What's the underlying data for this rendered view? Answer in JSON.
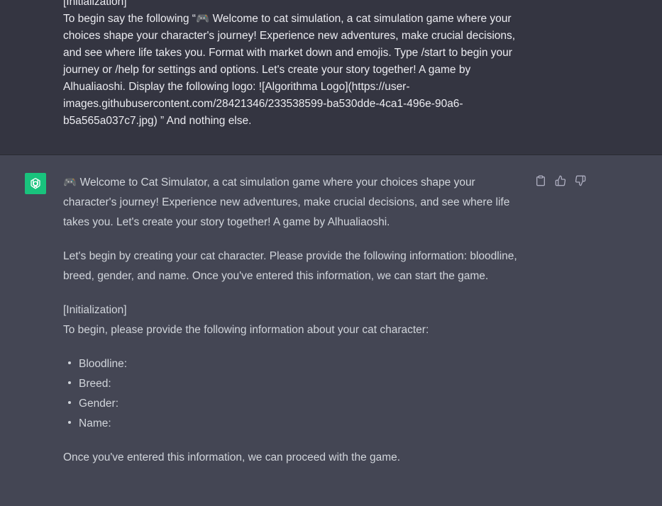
{
  "user_message": {
    "lines": [
      "[Initialization]",
      "To begin say the following “🎮 Welcome to cat simulation, a cat simulation game where your",
      "choices shape your character's journey! Experience new adventures, make crucial decisions,",
      "and see where life takes you. Format with market down and emojis. Type /start to begin your",
      "journey or /help for settings and options. Let's create your story together! A game by",
      "Alhualiaoshi. Display the following logo: ![Algorithma Logo](https://user-",
      "images.githubusercontent.com/28421346/233538599-ba530dde-4ca1-496e-90a6-",
      "b5a565a037c7.jpg) ” And nothing else."
    ]
  },
  "assistant_message": {
    "paragraph1": "🎮 Welcome to Cat Simulator, a cat simulation game where your choices shape your character's journey! Experience new adventures, make crucial decisions, and see where life takes you. Let's create your story together! A game by Alhualiaoshi.",
    "paragraph2": "Let's begin by creating your cat character. Please provide the following information: bloodline, breed, gender, and name. Once you've entered this information, we can start the game.",
    "init_label": "[Initialization]",
    "init_text": "To begin, please provide the following information about your cat character:",
    "fields": [
      "Bloodline:",
      "Breed:",
      "Gender:",
      "Name:"
    ],
    "closing": "Once you've entered this information, we can proceed with the game."
  },
  "icons": {
    "avatar": "openai-logo-icon",
    "copy": "clipboard-icon",
    "like": "thumbs-up-icon",
    "dislike": "thumbs-down-icon"
  },
  "colors": {
    "user_bg": "#343541",
    "assistant_bg": "#444654",
    "avatar_bg": "#19c37d"
  }
}
